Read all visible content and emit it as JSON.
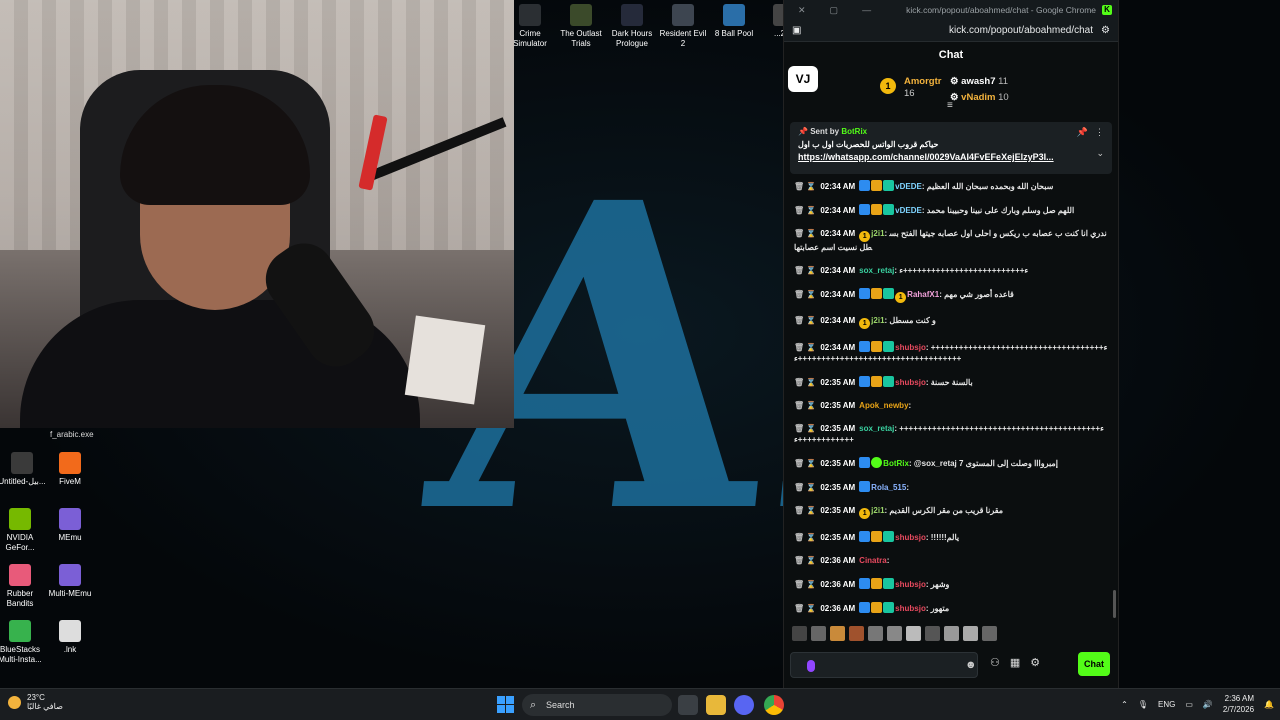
{
  "desktop": {
    "bg_text": "AB",
    "top_icons": [
      {
        "label": "Crime Simulator",
        "color": "#2b2f33"
      },
      {
        "label": "The Outlast Trials",
        "color": "#3b4a2a"
      },
      {
        "label": "Dark Hours Prologue",
        "color": "#252a3a"
      },
      {
        "label": "Resident Evil 2",
        "color": "#3d4550"
      },
      {
        "label": "8 Ball Pool",
        "color": "#2a6ea8"
      },
      {
        "label": "...202",
        "color": "#444"
      }
    ],
    "exe_label": "f_arabic.exe",
    "left_icons": [
      {
        "label": "Untitled-بيل...",
        "color": "#3a3a3a"
      },
      {
        "label": "FiveM",
        "color": "#f26a1b"
      },
      {
        "label": "NVIDIA GeFor...",
        "color": "#76b900"
      },
      {
        "label": "MEmu",
        "color": "#7b5fd6"
      },
      {
        "label": "Rubber Bandits",
        "color": "#e85a7a"
      },
      {
        "label": "Multi-MEmu",
        "color": "#7b5fd6"
      },
      {
        "label": "BlueStacks Multi-Insta...",
        "color": "#37b24d"
      },
      {
        "label": ".lnk",
        "color": "#dddddd"
      }
    ]
  },
  "chrome": {
    "window_title": "kick.com/popout/aboahmed/chat - Google Chrome",
    "url": "kick.com/popout/aboahmed/chat",
    "kick_letter": "K"
  },
  "chat": {
    "header": "Chat",
    "vj_logo": "VJ",
    "top_gifters": [
      {
        "rank": "1",
        "name": "Amorgtr",
        "count": "16",
        "color": "#f2b23d"
      },
      {
        "rank": "",
        "name": "awash7",
        "count": "11",
        "color": "#ffffff"
      },
      {
        "rank": "",
        "name": "vNadim",
        "count": "10",
        "color": "#f2b23d"
      }
    ],
    "pinned": {
      "sent_by_label": "Sent by",
      "sent_by_user": "BotRix",
      "text": "حياكم قروب الواتس للحصريات اول ب اول",
      "link": "https://whatsapp.com/channel/0029VaAI4FvEFeXejElzyP3I..."
    },
    "messages": [
      {
        "time": "02:34 AM",
        "user": "vDEDE",
        "user_color": "#7fd4ff",
        "text": "سبحان الله وبحمده سبحان الله العظيم",
        "badges": [
          "blue",
          "gold",
          "teal"
        ]
      },
      {
        "time": "02:34 AM",
        "user": "vDEDE",
        "user_color": "#7fd4ff",
        "text": "اللهم صل وسلم وبارك على نبينا وحبيبنا محمد",
        "badges": [
          "blue",
          "gold",
          "teal"
        ]
      },
      {
        "time": "02:34 AM",
        "user": "j2i1",
        "user_color": "#9bd56a",
        "text": "ندري انا كنت ب عصابه ب ريكس و احلى اول عصابه جيتها الفتح بسطل نسيت اسم عصابتها",
        "badges": [
          "num"
        ]
      },
      {
        "time": "02:34 AM",
        "user": "sox_retaj",
        "user_color": "#3ad1a0",
        "text": "ء++++++++++++++++++++++++++ء",
        "badges": []
      },
      {
        "time": "02:34 AM",
        "user": "RahafX1",
        "user_color": "#f0a0d8",
        "text": "قاعده أصور شي مهم",
        "badges": [
          "blue",
          "gold",
          "teal",
          "num"
        ]
      },
      {
        "time": "02:34 AM",
        "user": "j2i1",
        "user_color": "#9bd56a",
        "text": "و كنت مسطل",
        "badges": [
          "num"
        ]
      },
      {
        "time": "02:34 AM",
        "user": "shubsjo",
        "user_color": "#e84a5f",
        "text": "ء+++++++++++++++++++++++++++++++++++++++++++++++++++++++++++++++ء+++++++++",
        "badges": [
          "blue",
          "gold",
          "teal"
        ]
      },
      {
        "time": "02:35 AM",
        "user": "shubsjo",
        "user_color": "#e84a5f",
        "text": "بالسنة حسنة",
        "badges": [
          "blue",
          "gold",
          "teal"
        ]
      },
      {
        "time": "02:35 AM",
        "user": "Apok_newby",
        "user_color": "#e8a317",
        "text": "",
        "badges": []
      },
      {
        "time": "02:35 AM",
        "user": "sox_retaj",
        "user_color": "#3ad1a0",
        "text": "ء+++++++++++++++++++++++++++++++++++++++++++++++++++++++ء",
        "badges": []
      },
      {
        "time": "02:35 AM",
        "user": "BotRix",
        "user_color": "#53fc18",
        "text": "@sox_retaj إمبروااا وصلت إلى المستوى 7",
        "badges": [
          "blue",
          "g"
        ]
      },
      {
        "time": "02:35 AM",
        "user": "Rola_515",
        "user_color": "#8ab4ff",
        "text": "",
        "badges": [
          "blue"
        ]
      },
      {
        "time": "02:35 AM",
        "user": "j2i1",
        "user_color": "#9bd56a",
        "text": "مقرنا قريب من مقر الكرس القديم",
        "badges": [
          "num"
        ]
      },
      {
        "time": "02:35 AM",
        "user": "shubsjo",
        "user_color": "#e84a5f",
        "text": "!!!!!!يالم",
        "badges": [
          "blue",
          "gold",
          "teal"
        ]
      },
      {
        "time": "02:36 AM",
        "user": "Cinatra",
        "user_color": "#e84a5f",
        "text": "",
        "badges": []
      },
      {
        "time": "02:36 AM",
        "user": "shubsjo",
        "user_color": "#e84a5f",
        "text": "وشهر",
        "badges": [
          "blue",
          "gold",
          "teal"
        ]
      },
      {
        "time": "02:36 AM",
        "user": "shubsjo",
        "user_color": "#e84a5f",
        "text": "متهور",
        "badges": [
          "blue",
          "gold",
          "teal"
        ]
      }
    ],
    "send_label": "Chat"
  },
  "taskbar": {
    "temperature": "23°C",
    "weather_text": "صافي غالبًا",
    "search_label": "Search",
    "language": "ENG",
    "time": "2:36 AM",
    "date": "2/7/2026"
  }
}
